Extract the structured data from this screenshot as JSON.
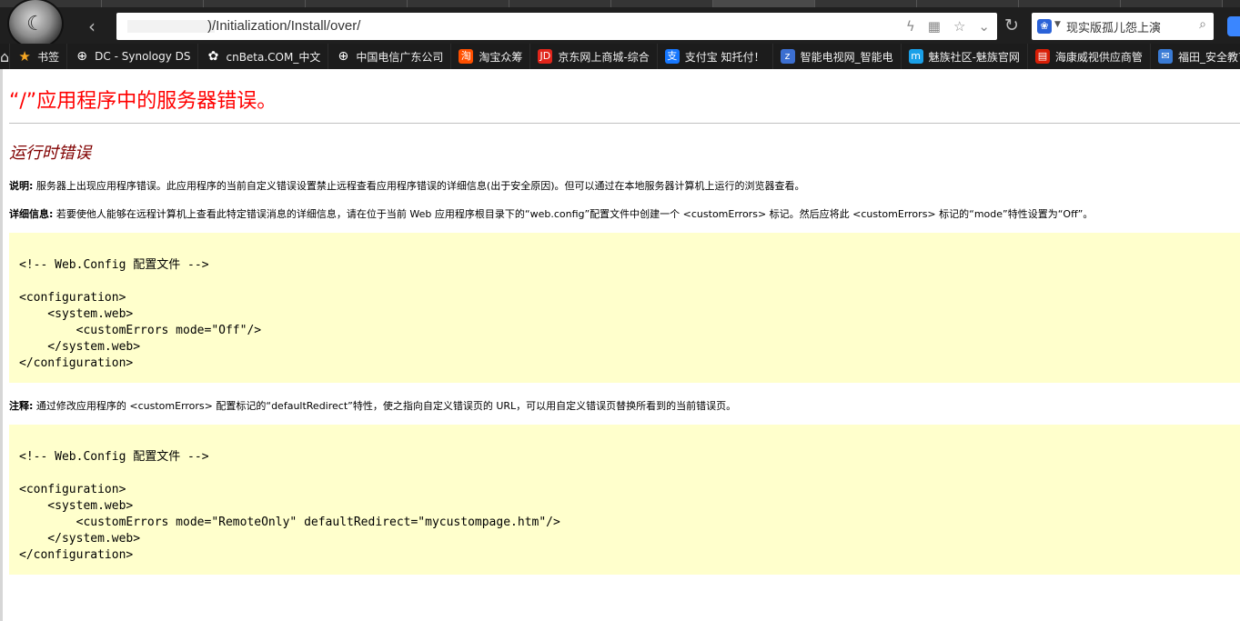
{
  "browser": {
    "url_suffix": ")/Initialization/Install/over/",
    "search_text": "现实版孤儿怨上演",
    "bookmarks": [
      {
        "label": "书签",
        "icon": "star-icon",
        "color": "#f5a623",
        "glyph": "★"
      },
      {
        "label": "DC - Synology DS",
        "icon": "globe-icon",
        "color": "#444444",
        "glyph": "⊕"
      },
      {
        "label": "cnBeta.COM_中文",
        "icon": "cnbeta-icon",
        "color": "#444444",
        "glyph": "✿"
      },
      {
        "label": "中国电信广东公司",
        "icon": "globe-icon",
        "color": "#444444",
        "glyph": "⊕"
      },
      {
        "label": "淘宝众筹",
        "icon": "taobao-icon",
        "color": "#ff5000",
        "glyph": "淘"
      },
      {
        "label": "京东网上商城-综合",
        "icon": "jd-icon",
        "color": "#e1251b",
        "glyph": "JD"
      },
      {
        "label": "支付宝 知托付！",
        "icon": "alipay-icon",
        "color": "#1677ff",
        "glyph": "支"
      },
      {
        "label": "智能电视网_智能电",
        "icon": "tv-icon",
        "color": "#3c6fd1",
        "glyph": "z"
      },
      {
        "label": "魅族社区-魅族官网",
        "icon": "meizu-icon",
        "color": "#1aa0e8",
        "glyph": "m"
      },
      {
        "label": "海康威视供应商管",
        "icon": "hikvision-icon",
        "color": "#d81e06",
        "glyph": "▤"
      },
      {
        "label": "福田_安全教育平台",
        "icon": "mail-icon",
        "color": "#3a7bd5",
        "glyph": "✉"
      }
    ]
  },
  "page": {
    "title": "“/”应用程序中的服务器错误。",
    "subtitle": "运行时错误",
    "desc_label": "说明:",
    "desc_text": " 服务器上出现应用程序错误。此应用程序的当前自定义错误设置禁止远程查看应用程序错误的详细信息(出于安全原因)。但可以通过在本地服务器计算机上运行的浏览器查看。",
    "detail_label": "详细信息:",
    "detail_text": " 若要使他人能够在远程计算机上查看此特定错误消息的详细信息，请在位于当前 Web 应用程序根目录下的“web.config”配置文件中创建一个 <customErrors> 标记。然后应将此 <customErrors> 标记的“mode”特性设置为“Off”。",
    "code1": "<!-- Web.Config 配置文件 -->\n\n<configuration>\n    <system.web>\n        <customErrors mode=\"Off\"/>\n    </system.web>\n</configuration>",
    "note_label": "注释:",
    "note_text": " 通过修改应用程序的 <customErrors> 配置标记的“defaultRedirect”特性，使之指向自定义错误页的 URL，可以用自定义错误页替换所看到的当前错误页。",
    "code2": "<!-- Web.Config 配置文件 -->\n\n<configuration>\n    <system.web>\n        <customErrors mode=\"RemoteOnly\" defaultRedirect=\"mycustompage.htm\"/>\n    </system.web>\n</configuration>"
  }
}
